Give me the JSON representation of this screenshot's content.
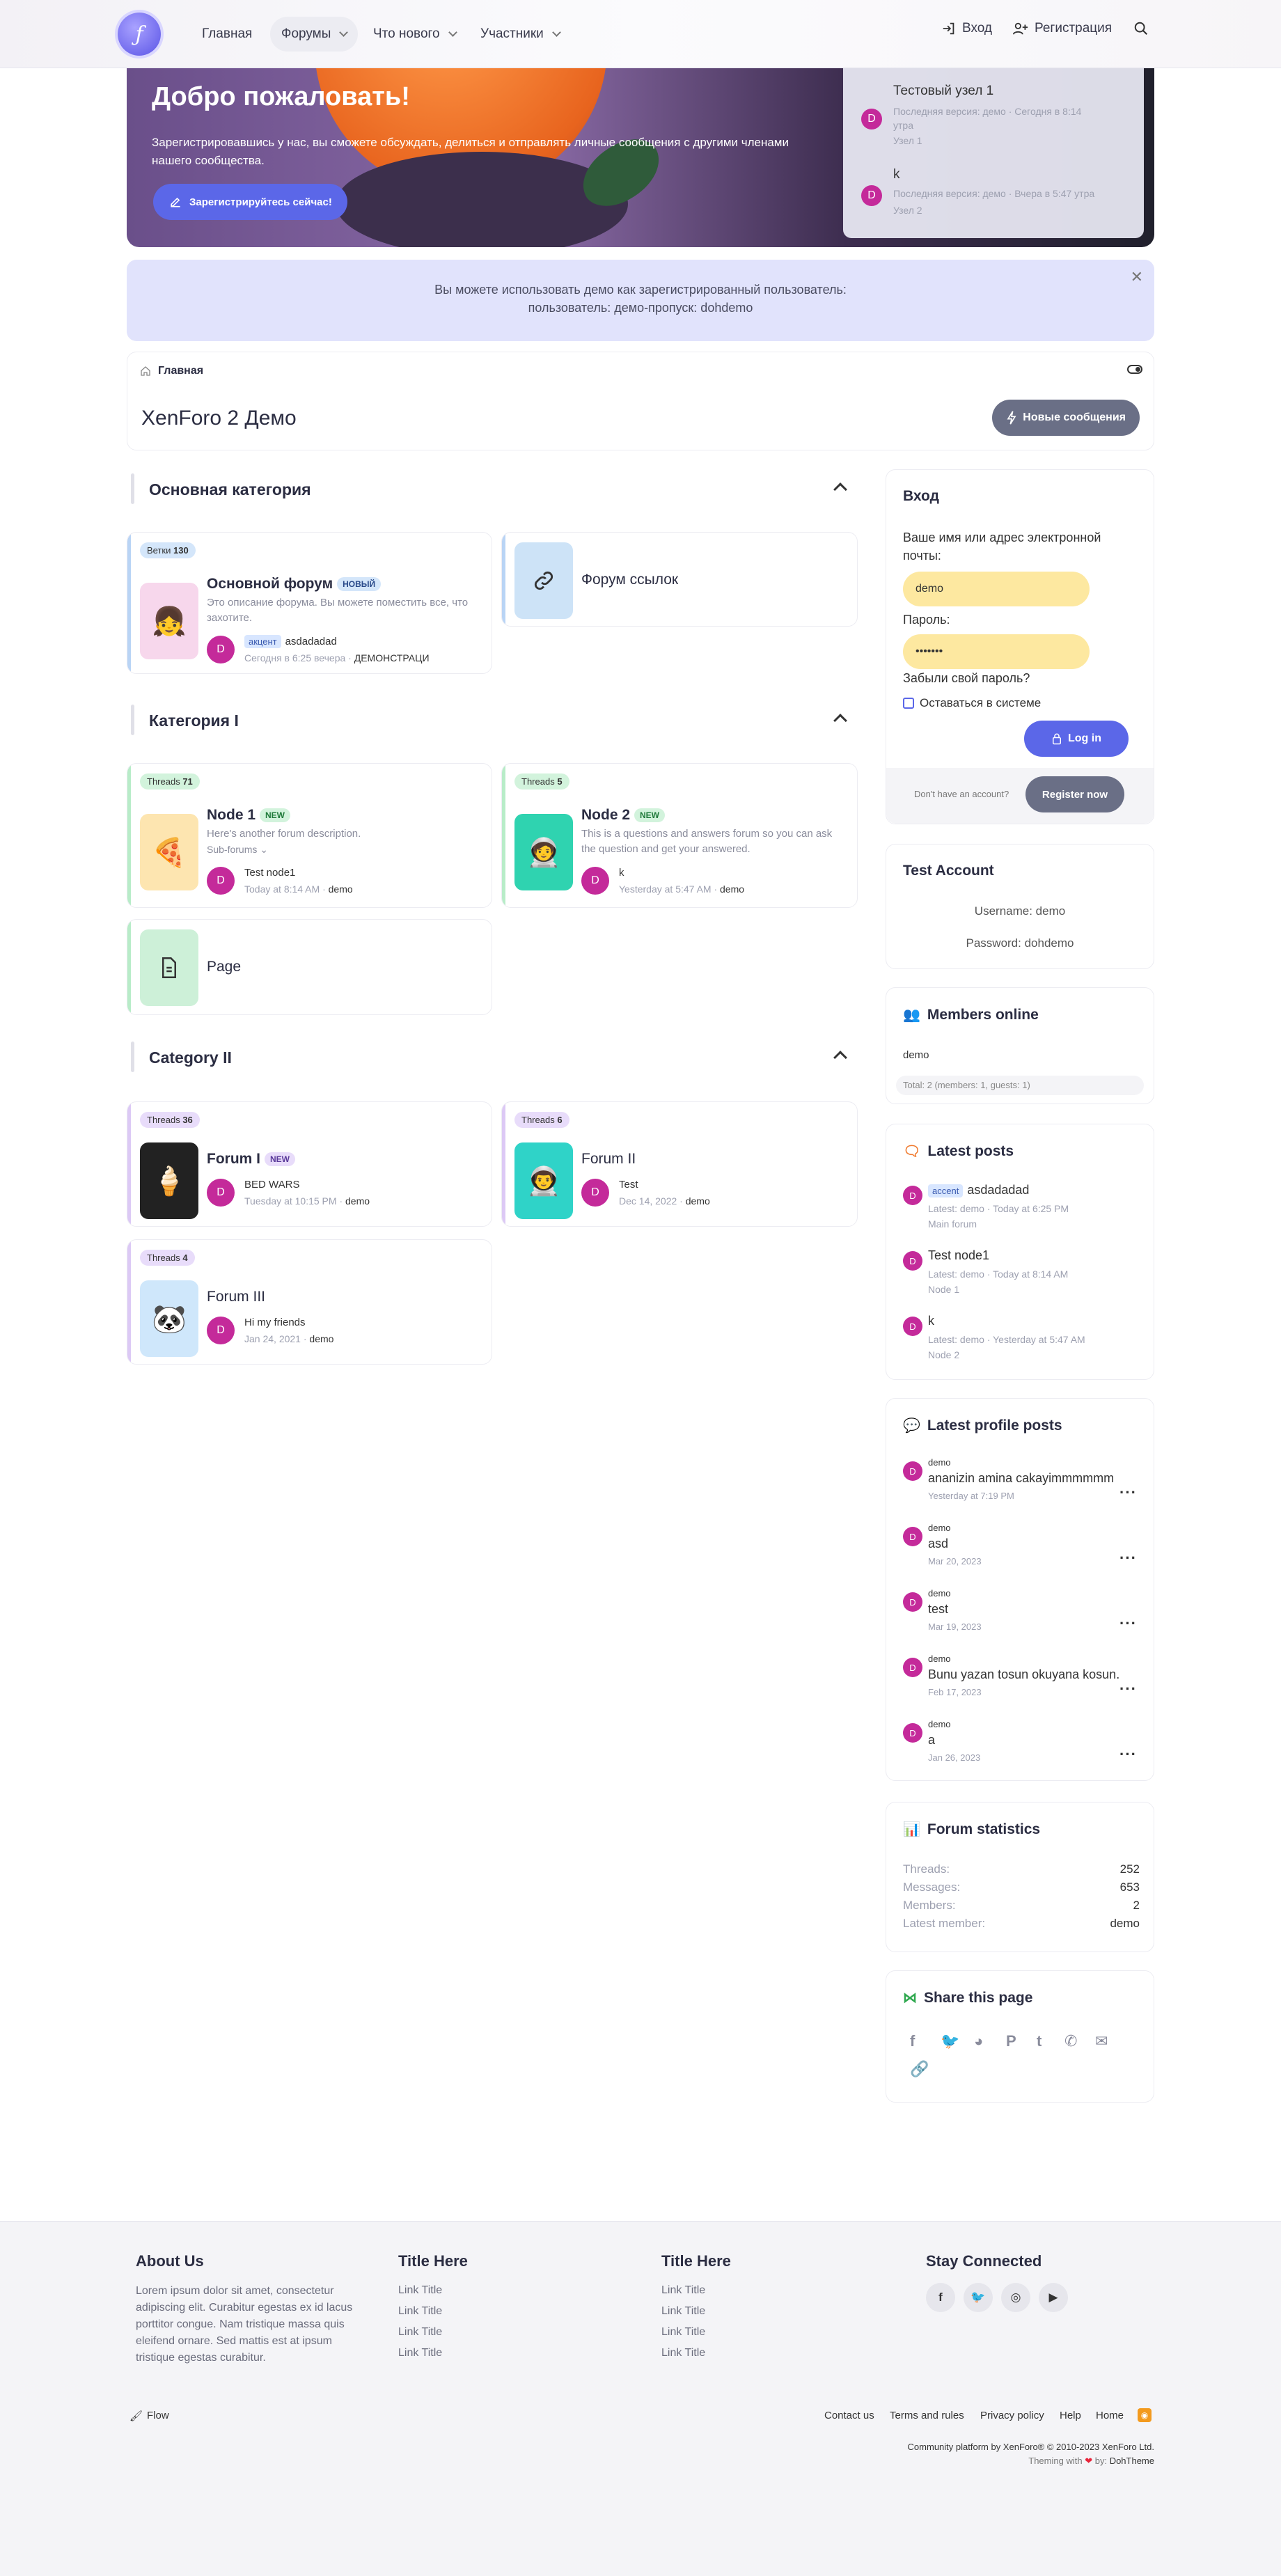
{
  "header": {
    "logo_glyph": "ƒ",
    "nav": [
      "Главная",
      "Форумы",
      "Что нового",
      "Участники"
    ],
    "login": "Вход",
    "register": "Регистрация"
  },
  "hero": {
    "title": "Добро пожаловать!",
    "text": "Зарегистрировавшись у нас, вы сможете обсуждать, делиться и отправлять личные сообщения с другими членами нашего сообщества.",
    "button": "Зарегистрируйтесь сейчас!",
    "items": [
      {
        "title": "Тестовый узел 1",
        "meta1": "Последняя версия: демо · Сегодня в 8:14",
        "meta2": "утра",
        "meta3": "Узел 1",
        "avatar": "D"
      },
      {
        "title": "k",
        "meta1": "Последняя версия: демо · Вчера в 5:47 утра",
        "meta2": "Узел 2",
        "avatar": "D"
      }
    ]
  },
  "notice": {
    "line1": "Вы можете использовать демо как зарегистрированный пользователь:",
    "line2": "пользователь: демо-пропуск: dohdemo"
  },
  "breadcrumb": {
    "home": "Главная"
  },
  "page_title": "XenForo 2 Демо",
  "new_posts_button": "Новые сообщения",
  "categories": [
    {
      "title": "Основная категория"
    },
    {
      "title": "Категория I"
    },
    {
      "title": "Category II"
    }
  ],
  "nodes": {
    "main": {
      "badge_label": "Ветки",
      "badge_count": "130",
      "title": "Основной форум",
      "new": "НОВЫЙ",
      "desc": "Это описание форума. Вы можете поместить все, что захотите.",
      "tag": "акцент",
      "last_title": "asdadadad",
      "last_meta": "Сегодня в 6:25 вечера ·",
      "last_user": "ДЕМОНСТРАЦИ",
      "avatar": "D"
    },
    "links": {
      "title": "Форум ссылок"
    },
    "node1": {
      "badge_label": "Threads",
      "badge_count": "71",
      "title": "Node 1",
      "new": "NEW",
      "desc": "Here's another forum description.",
      "sub": "Sub-forums",
      "last_title": "Test node1",
      "last_meta": "Today at 8:14 AM ·",
      "last_user": "demo",
      "avatar": "D"
    },
    "node2": {
      "badge_label": "Threads",
      "badge_count": "5",
      "title": "Node 2",
      "new": "NEW",
      "desc1": "This is a questions and answers forum so you can ask",
      "desc2": "the question and get your answered.",
      "last_title": "k",
      "last_meta": "Yesterday at 5:47 AM ·",
      "last_user": "demo",
      "avatar": "D"
    },
    "page": {
      "title": "Page"
    },
    "forum1": {
      "badge_label": "Threads",
      "badge_count": "36",
      "title": "Forum I",
      "new": "NEW",
      "last_title": "BED WARS",
      "last_meta": "Tuesday at 10:15 PM ·",
      "last_user": "demo",
      "avatar": "D"
    },
    "forum2": {
      "badge_label": "Threads",
      "badge_count": "6",
      "title": "Forum II",
      "last_title": "Test",
      "last_meta": "Dec 14, 2022 ·",
      "last_user": "demo",
      "avatar": "D"
    },
    "forum3": {
      "badge_label": "Threads",
      "badge_count": "4",
      "title": "Forum III",
      "last_title": "Hi my friends",
      "last_meta": "Jan 24, 2021 ·",
      "last_user": "demo",
      "avatar": "D"
    }
  },
  "login": {
    "title": "Вход",
    "user_label": "Ваше имя или адрес электронной почты:",
    "user_value": "demo",
    "pass_label": "Пароль:",
    "pass_value": "•••••••",
    "forgot": "Забыли свой пароль?",
    "remember": "Оставаться в системе",
    "login_btn": "Log in",
    "no_account": "Don't have an account?",
    "register_btn": "Register now"
  },
  "test_account": {
    "title": "Test Account",
    "username": "Username: demo",
    "password": "Password: dohdemo"
  },
  "members_online": {
    "title": "Members online",
    "user": "demo",
    "total": "Total: 2 (members: 1, guests: 1)"
  },
  "latest_posts": {
    "title": "Latest posts",
    "items": [
      {
        "tag": "accent",
        "title": "asdadadad",
        "meta": "Latest: demo · Today at 6:25 PM",
        "forum": "Main forum",
        "avatar": "D"
      },
      {
        "title": "Test node1",
        "meta": "Latest: demo · Today at 8:14 AM",
        "forum": "Node 1",
        "avatar": "D"
      },
      {
        "title": "k",
        "meta": "Latest: demo · Yesterday at 5:47 AM",
        "forum": "Node 2",
        "avatar": "D"
      }
    ]
  },
  "latest_profile_posts": {
    "title": "Latest profile posts",
    "items": [
      {
        "user": "demo",
        "text": "ananizin amina cakayimmmmmm",
        "date": "Yesterday at 7:19 PM",
        "avatar": "D"
      },
      {
        "user": "demo",
        "text": "asd",
        "date": "Mar 20, 2023",
        "avatar": "D"
      },
      {
        "user": "demo",
        "text": "test",
        "date": "Mar 19, 2023",
        "avatar": "D"
      },
      {
        "user": "demo",
        "text": "Bunu yazan tosun okuyana kosun.",
        "date": "Feb 17, 2023",
        "avatar": "D"
      },
      {
        "user": "demo",
        "text": "a",
        "date": "Jan 26, 2023",
        "avatar": "D"
      }
    ]
  },
  "forum_stats": {
    "title": "Forum statistics",
    "rows": [
      {
        "k": "Threads:",
        "v": "252"
      },
      {
        "k": "Messages:",
        "v": "653"
      },
      {
        "k": "Members:",
        "v": "2"
      },
      {
        "k": "Latest member:",
        "v": "demo"
      }
    ]
  },
  "share": {
    "title": "Share this page"
  },
  "footer": {
    "about_title": "About Us",
    "about_text": "Lorem ipsum dolor sit amet, consectetur adipiscing elit. Curabitur egestas ex id lacus porttitor congue. Nam tristique massa quis eleifend ornare. Sed mattis est at ipsum tristique egestas curabitur.",
    "col2_title": "Title Here",
    "col3_title": "Title Here",
    "link": "Link Title",
    "stay": "Stay Connected",
    "style": "Flow",
    "links": [
      "Contact us",
      "Terms and rules",
      "Privacy policy",
      "Help",
      "Home"
    ],
    "credit1": "Community platform by XenForo® © 2010-2023 XenForo Ltd.",
    "credit2": "Theming with",
    "credit3": "by:",
    "credit4": "DohTheme"
  },
  "colors": {
    "accent": "#5b67e8",
    "node_blue": "#b9d4f5",
    "node_green": "#b8ecc8",
    "node_purple": "#dcc9f5"
  }
}
